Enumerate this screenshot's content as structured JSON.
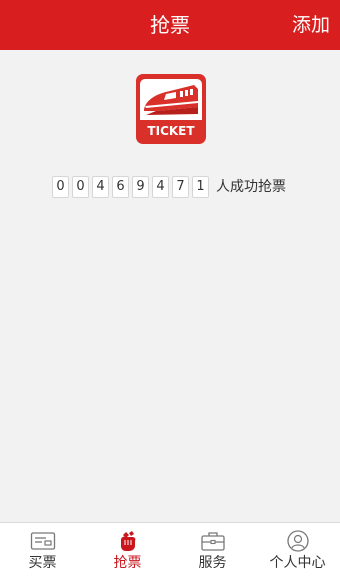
{
  "header": {
    "title": "抢票",
    "add_label": "添加"
  },
  "logo": {
    "text": "TICKET"
  },
  "counter": {
    "digits": [
      "0",
      "0",
      "4",
      "6",
      "9",
      "4",
      "7",
      "1"
    ],
    "suffix": "人成功抢票"
  },
  "tabs": [
    {
      "label": "买票",
      "icon": "ticket-icon",
      "active": false
    },
    {
      "label": "抢票",
      "icon": "grab-hand-icon",
      "active": true
    },
    {
      "label": "服务",
      "icon": "briefcase-icon",
      "active": false
    },
    {
      "label": "个人中心",
      "icon": "user-icon",
      "active": false
    }
  ],
  "colors": {
    "brand_red": "#d81e1e",
    "active_tab": "#c8161d",
    "background": "#f2f2f2"
  }
}
